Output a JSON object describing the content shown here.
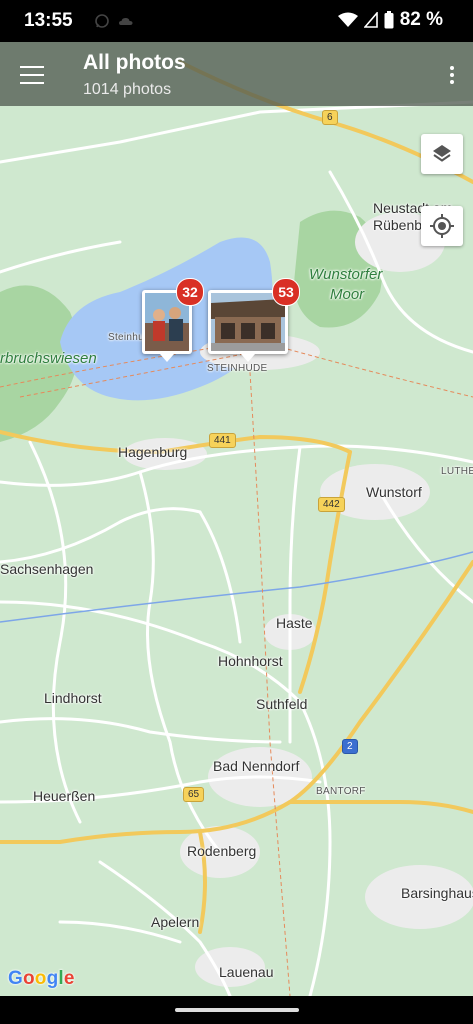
{
  "status_bar": {
    "time": "13:55",
    "battery": "82 %"
  },
  "app_bar": {
    "title": "All photos",
    "subtitle": "1014 photos"
  },
  "clusters": [
    {
      "count": "32"
    },
    {
      "count": "53"
    }
  ],
  "map": {
    "places": {
      "neustadt_1": "Neustadt am",
      "neustadt_2": "Rübenb",
      "wunstorfer_1": "Wunstorfer",
      "wunstorfer_2": "Moor",
      "steinhude_lake": "Steinhude",
      "bruchswiesen": "rbruchswiesen",
      "steinhude": "STEINHUDE",
      "hagenburg": "Hagenburg",
      "luthe": "LUTHE",
      "wunstorf": "Wunstorf",
      "sachsenhagen": "Sachsenhagen",
      "haste": "Haste",
      "hohnhorst": "Hohnhorst",
      "lindhorst": "Lindhorst",
      "suthfeld": "Suthfeld",
      "bad_nenndorf": "Bad Nenndorf",
      "heuerssen": "Heuerßen",
      "bantorf": "BANTORF",
      "rodenberg": "Rodenberg",
      "barsinghausen": "Barsinghaus",
      "apelern": "Apelern",
      "lauenau": "Lauenau"
    },
    "road_numbers": {
      "r6": "6",
      "r441": "441",
      "r442": "442",
      "r2": "2",
      "r65": "65"
    },
    "attribution": "Google",
    "colors": {
      "land": "#cfe8cf",
      "water": "#a6c8f5",
      "forest": "#a8d5a2",
      "road": "#ffffff",
      "highway": "#f2c95c"
    }
  }
}
